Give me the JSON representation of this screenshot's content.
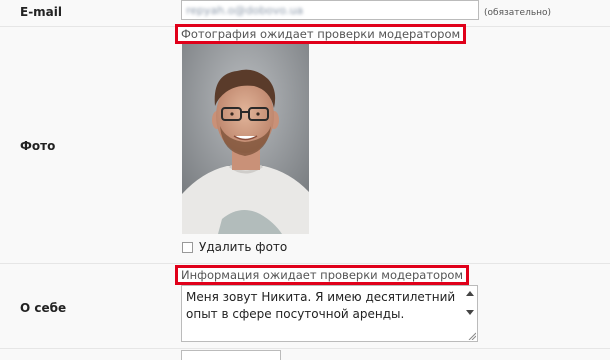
{
  "email": {
    "label": "E-mail",
    "value": "repyah.o@dobovo.ua",
    "required_hint": "(обязательно)"
  },
  "photo": {
    "label": "Фото",
    "moderation_notice": "Фотография ожидает проверки модератором",
    "delete_label": "Удалить фото",
    "delete_checked": false
  },
  "about": {
    "label": "О себе",
    "moderation_notice": "Информация ожидает проверки модератором",
    "text": "Меня зовут Никита. Я имею десятилетний опыт в сфере посуточной аренды."
  },
  "colors": {
    "notice_border": "#e0001a",
    "background": "#f9f9f9"
  }
}
